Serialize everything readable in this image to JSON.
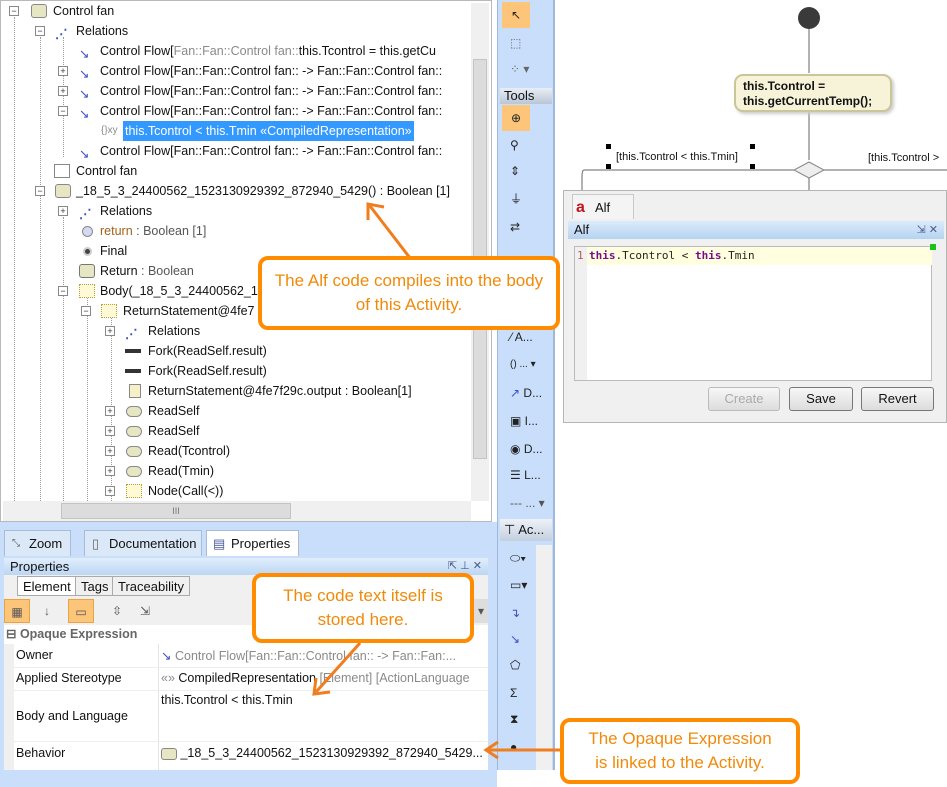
{
  "tree": {
    "rows": [
      {
        "label": "Control fan"
      },
      {
        "label": "Relations"
      },
      {
        "prefix": "Control Flow[",
        "gray": "Fan::Fan::Control fan::",
        "label": "this.Tcontrol =  this.getCu"
      },
      {
        "label": "Control Flow[Fan::Fan::Control fan:: -> Fan::Fan::Control fan::"
      },
      {
        "label": "Control Flow[Fan::Fan::Control fan:: -> Fan::Fan::Control fan::"
      },
      {
        "label": "Control Flow[Fan::Fan::Control fan:: -> Fan::Fan::Control fan::"
      },
      {
        "icon_text": "{}xy",
        "label": "this.Tcontrol < this.Tmin «CompiledRepresentation»"
      },
      {
        "label": "Control Flow[Fan::Fan::Control fan:: -> Fan::Fan::Control fan::"
      },
      {
        "label": "Control fan"
      },
      {
        "label": "_18_5_3_24400562_1523130929392_872940_5429() : Boolean [1]"
      },
      {
        "label": "Relations"
      },
      {
        "label": "return",
        "suffix": " : Boolean [1]"
      },
      {
        "label": "Final"
      },
      {
        "label": "Return",
        "suffix": " : Boolean"
      },
      {
        "label": "Body(_18_5_3_24400562_1"
      },
      {
        "label": "ReturnStatement@4fe7"
      },
      {
        "label": "Relations"
      },
      {
        "label": "Fork(ReadSelf.result)"
      },
      {
        "label": "Fork(ReadSelf.result)"
      },
      {
        "label": "ReturnStatement@4fe7f29c.output : Boolean[1]"
      },
      {
        "label": "ReadSelf"
      },
      {
        "label": "ReadSelf"
      },
      {
        "label": "Read(Tcontrol)"
      },
      {
        "label": "Read(Tmin)"
      },
      {
        "label": "Node(Call(<))"
      }
    ],
    "hscroll_grip": "III"
  },
  "bottom_tabs": [
    "Zoom",
    "Documentation",
    "Properties"
  ],
  "properties": {
    "title": "Properties",
    "subtabs": [
      "Element",
      "Tags",
      "Traceability"
    ],
    "section": "Opaque Expression",
    "rows": [
      {
        "label": "Owner",
        "value": "Control Flow[Fan::Fan::Control fan:: -> Fan::Fan:..."
      },
      {
        "label": "Applied Stereotype",
        "prefix": "«»",
        "value": "CompiledRepresentation",
        "extra": " [Element] [ActionLanguage"
      },
      {
        "label": "Body and Language",
        "value": "this.Tcontrol < this.Tmin"
      },
      {
        "label": "Behavior",
        "value": "_18_5_3_24400562_1523130929392_872940_5429..."
      }
    ]
  },
  "palette": {
    "section": "Tools",
    "items": [
      "A...",
      "...",
      "D...",
      "I...",
      "D...",
      "L...",
      "...",
      "Ac..."
    ]
  },
  "diagram": {
    "action": "this.Tcontrol =\nthis.getCurrentTemp();",
    "action_l1": "this.Tcontrol =",
    "action_l2": "this.getCurrentTemp();",
    "guard_left": "[this.Tcontrol < this.Tmin]",
    "guard_right": "[this.Tcontrol >"
  },
  "alf": {
    "tab": "Alf",
    "title": "Alf",
    "line_no": "1",
    "code": [
      {
        "kw": "this"
      },
      {
        "t": ".Tcontrol < "
      },
      {
        "kw": "this"
      },
      {
        "t": ".Tmin"
      }
    ],
    "buttons": {
      "create": "Create",
      "save": "Save",
      "revert": "Revert"
    }
  },
  "callouts": {
    "c1": "The Alf code compiles into the body of this Activity.",
    "c2": "The code text itself is stored here.",
    "c3": "The Opaque Expression is linked to the Activity.",
    "color": "#ff8c00"
  }
}
